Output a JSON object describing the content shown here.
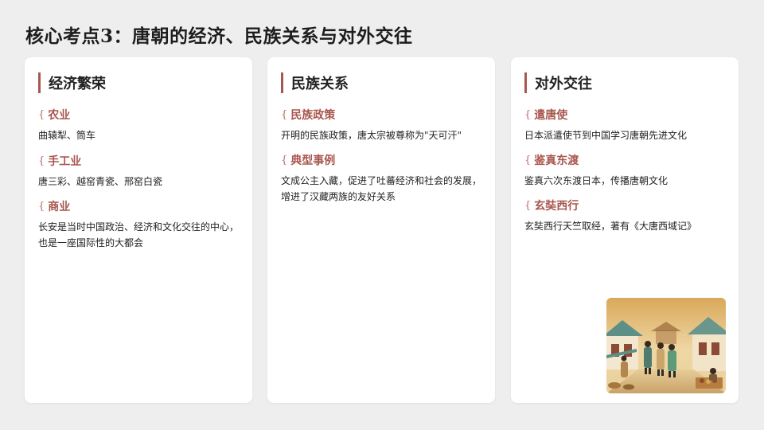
{
  "page": {
    "title": "核心考点3：唐朝的经济、民族关系与对外交往"
  },
  "cards": [
    {
      "title": "经济繁荣",
      "sections": [
        {
          "title": "农业",
          "text": "曲辕犁、筒车"
        },
        {
          "title": "手工业",
          "text": "唐三彩、越窑青瓷、邢窑白瓷"
        },
        {
          "title": "商业",
          "text": "长安是当时中国政治、经济和文化交往的中心，也是一座国际性的大都会"
        }
      ]
    },
    {
      "title": "民族关系",
      "sections": [
        {
          "title": "民族政策",
          "text": "开明的民族政策，唐太宗被尊称为\"天可汗\""
        },
        {
          "title": "典型事例",
          "text": "文成公主入藏，促进了吐蕃经济和社会的发展，增进了汉藏两族的友好关系"
        }
      ]
    },
    {
      "title": "对外交往",
      "sections": [
        {
          "title": "遣唐使",
          "text": "日本派遣使节到中国学习唐朝先进文化"
        },
        {
          "title": "鉴真东渡",
          "text": "鉴真六次东渡日本，传播唐朝文化"
        },
        {
          "title": "玄奘西行",
          "text": "玄奘西行天竺取经，著有《大唐西域记》"
        }
      ]
    }
  ],
  "illustration": {
    "subject": "tang-chang-an-street-scene"
  },
  "colors": {
    "accent": "#a8574e",
    "background": "#eeeeee",
    "card": "#ffffff"
  }
}
